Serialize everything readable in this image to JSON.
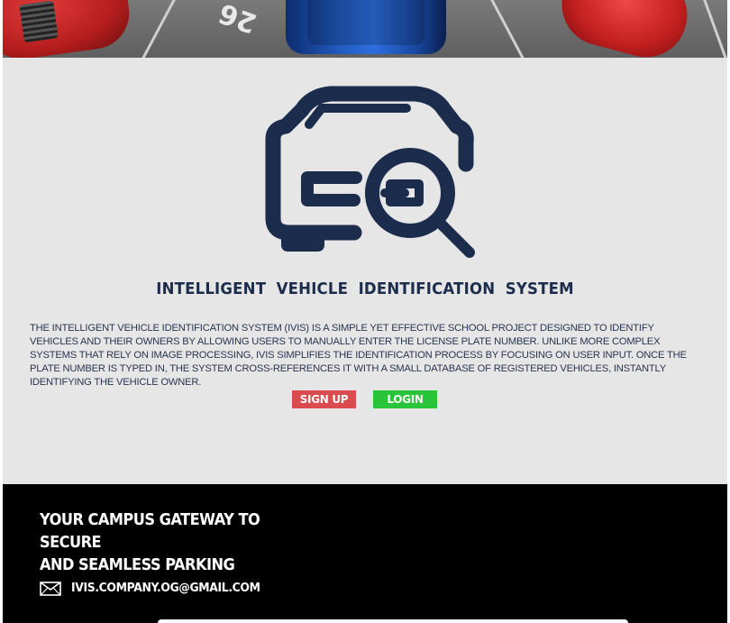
{
  "hero": {
    "spot_number": "26"
  },
  "logo": {
    "icon": "car-search-icon",
    "color": "#1c2c4c"
  },
  "main": {
    "title": "INTELLIGENT VEHICLE IDENTIFICATION SYSTEM",
    "description": "THE INTELLIGENT VEHICLE IDENTIFICATION SYSTEM (IVIS) IS A SIMPLE YET EFFECTIVE SCHOOL PROJECT DESIGNED TO IDENTIFY VEHICLES AND THEIR OWNERS BY ALLOWING USERS TO MANUALLY ENTER THE LICENSE PLATE NUMBER. UNLIKE MORE COMPLEX SYSTEMS THAT RELY ON IMAGE PROCESSING, IVIS SIMPLIFIES THE IDENTIFICATION PROCESS BY FOCUSING ON USER INPUT. ONCE THE PLATE NUMBER IS TYPED IN, THE SYSTEM CROSS-REFERENCES IT WITH A SMALL DATABASE OF REGISTERED VEHICLES, INSTANTLY IDENTIFYING THE VEHICLE OWNER.",
    "signup_label": "SIGN UP",
    "login_label": "LOGIN",
    "signup_color": "#d94b4e",
    "login_color": "#28c43a"
  },
  "footer": {
    "tagline_line1": "YOUR CAMPUS GATEWAY TO SECURE",
    "tagline_line2": "AND SEAMLESS PARKING",
    "email_icon": "mail-icon",
    "email": "IVIS.COMPANY.OG@GMAIL.COM"
  }
}
